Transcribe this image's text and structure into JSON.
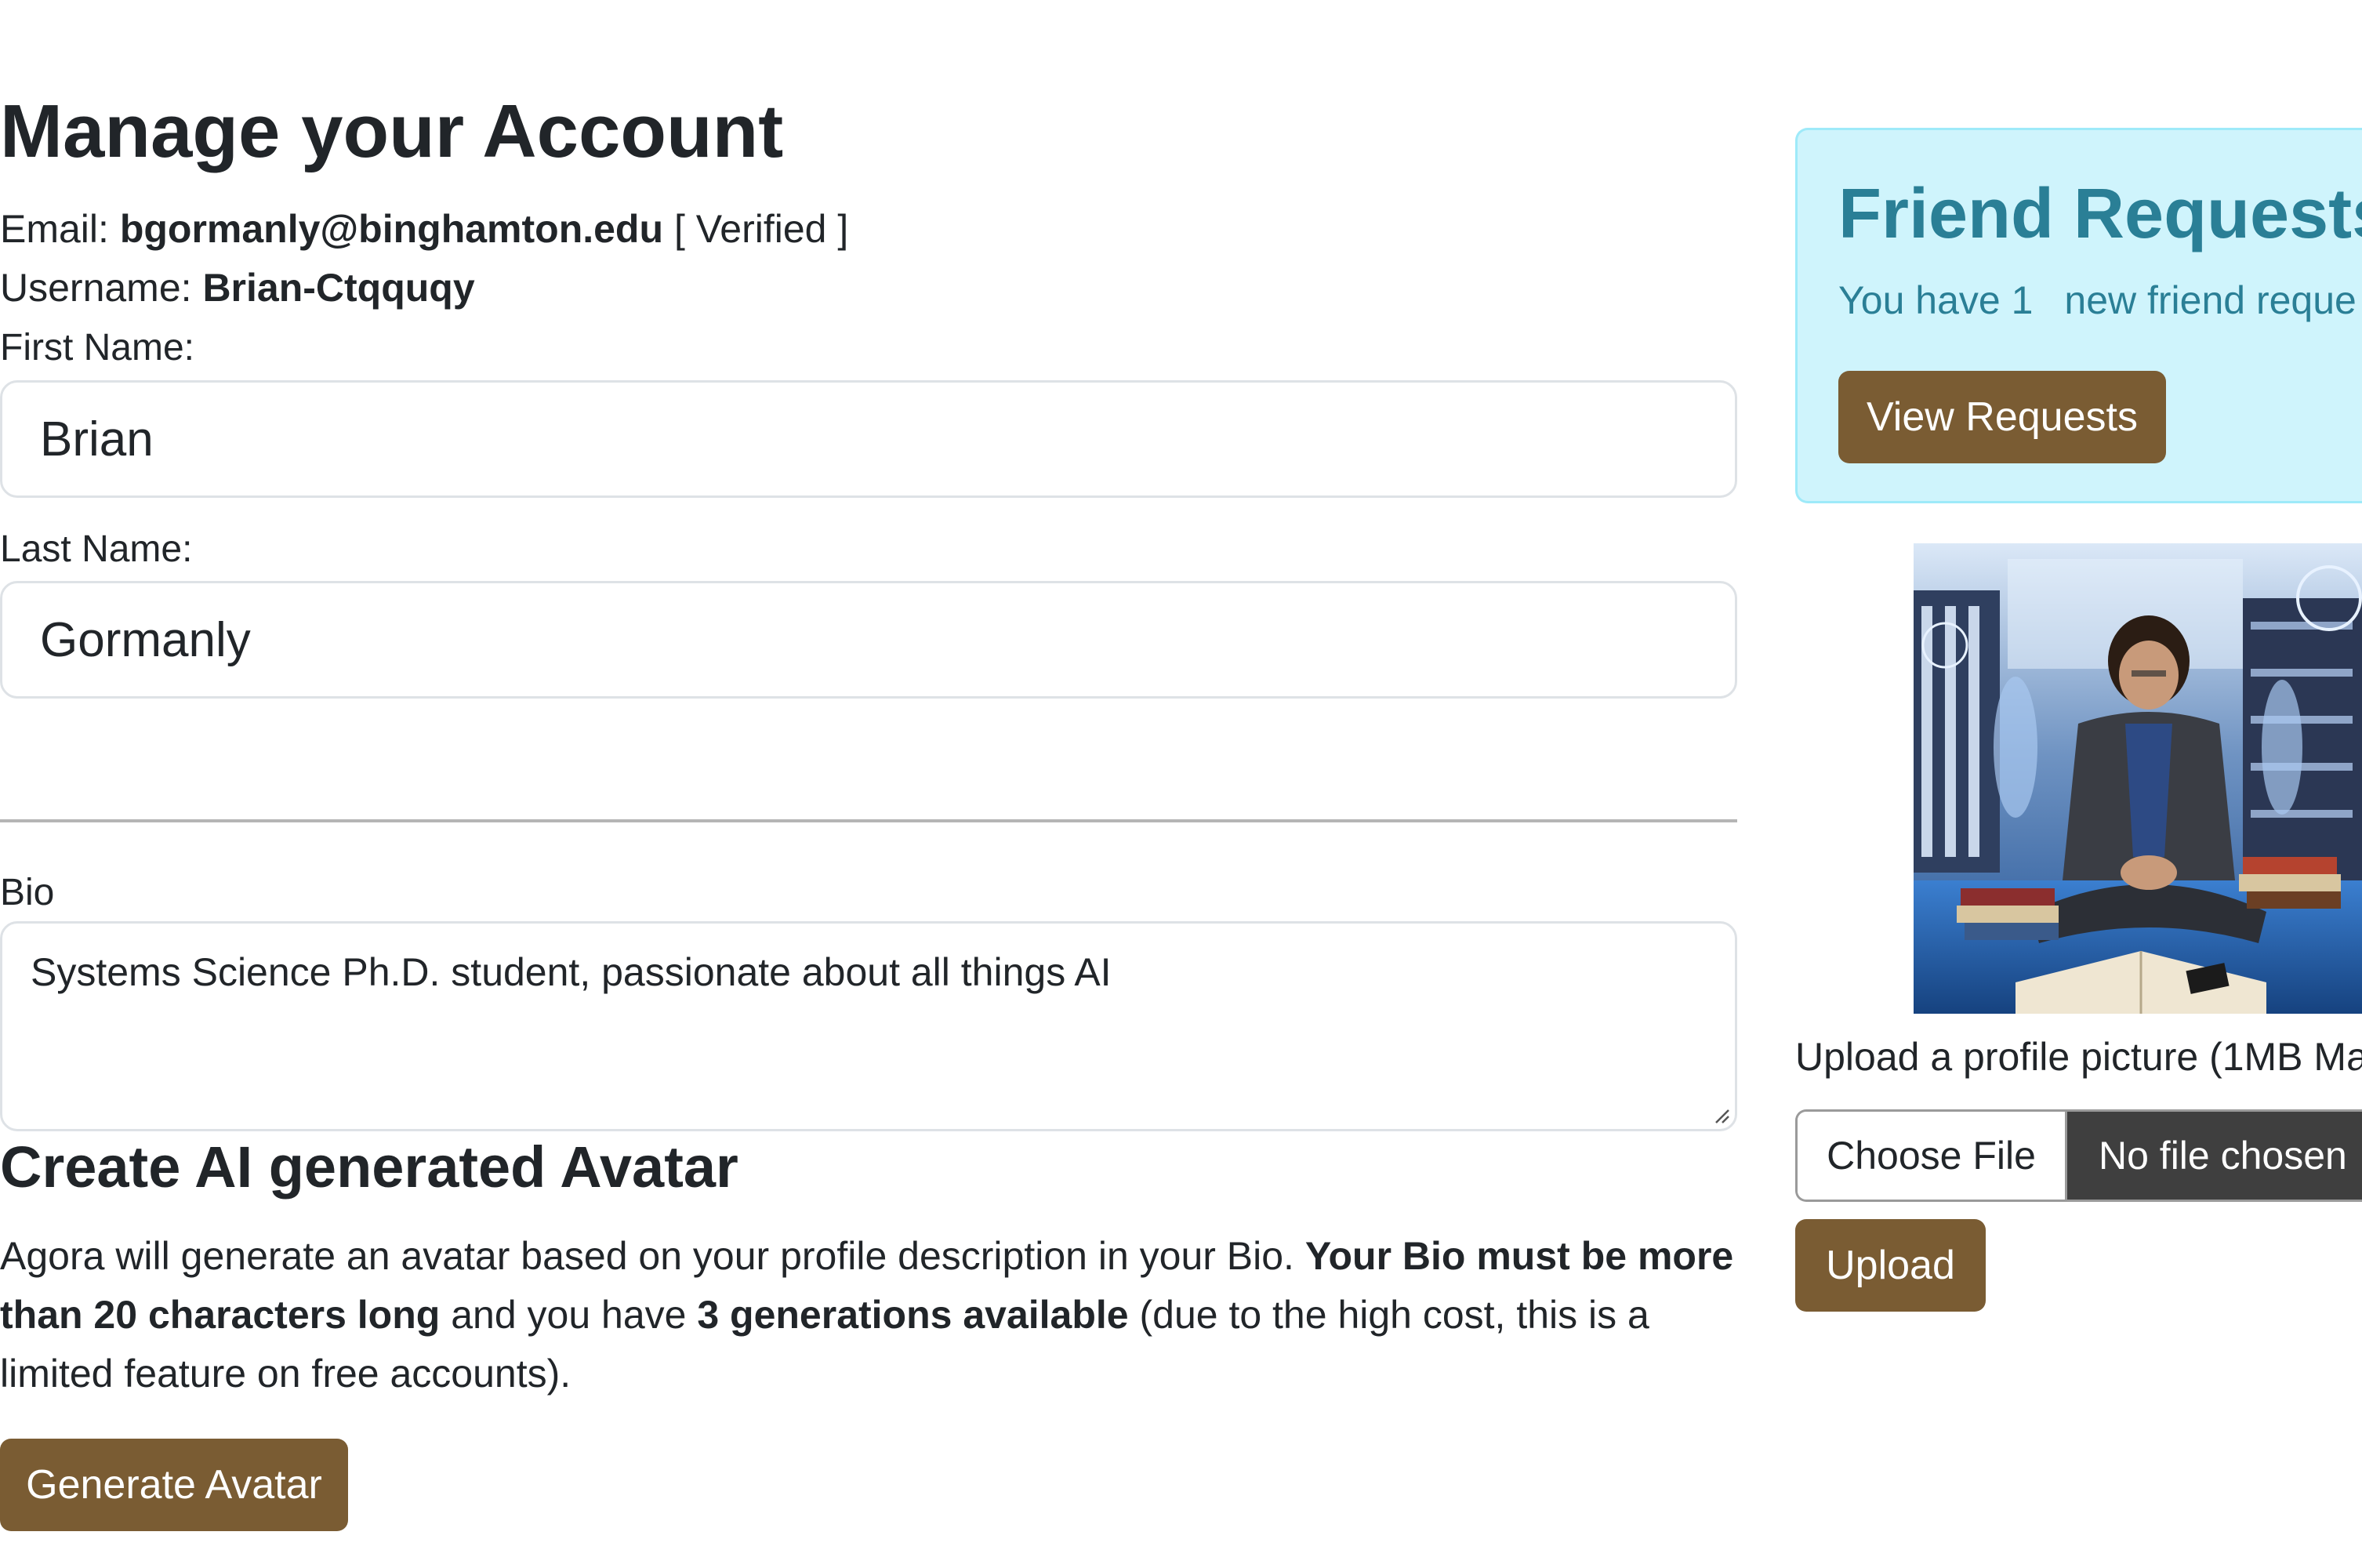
{
  "page": {
    "title": "Manage your Account"
  },
  "account": {
    "email_label": "Email:",
    "email_value": "bgormanly@binghamton.edu",
    "email_status": "[ Verified ]",
    "username_label": "Username:",
    "username_value": "Brian-Ctqquqy"
  },
  "form": {
    "first_name_label": "First Name:",
    "first_name_value": "Brian",
    "last_name_label": "Last Name:",
    "last_name_value": "Gormanly",
    "bio_label": "Bio",
    "bio_value": "Systems Science Ph.D. student, passionate about all things AI"
  },
  "avatar_section": {
    "title": "Create AI generated Avatar",
    "text_1": "Agora will generate an avatar based on your profile description in your Bio. ",
    "bold_1": "Your Bio must be more than 20 characters long",
    "text_2": " and you have ",
    "bold_2": "3 generations available",
    "text_3": " (due to the high cost, this is a limited feature on free accounts).",
    "button_label": "Generate Avatar"
  },
  "friend_requests": {
    "title": "Friend Requests",
    "text_prefix": "You have 1",
    "text_suffix": "new friend reque",
    "button_label": "View Requests"
  },
  "profile_picture": {
    "upload_label": "Upload a profile picture (1MB Ma",
    "choose_file_label": "Choose File",
    "file_status": "No file chosen",
    "upload_button_label": "Upload"
  },
  "colors": {
    "brand_brown": "#7a5c33",
    "info_bg": "#cff4fc",
    "info_text": "#2a7f96"
  }
}
